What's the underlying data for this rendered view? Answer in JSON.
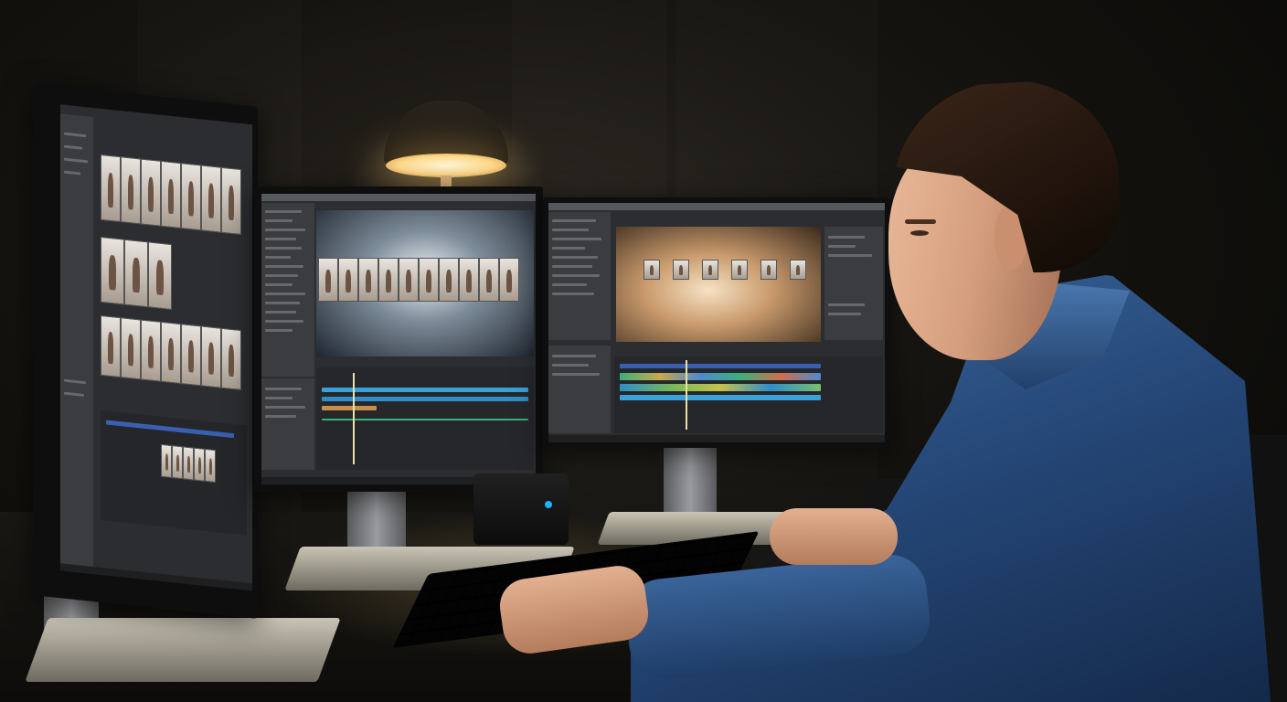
{
  "scene": {
    "kind": "photograph",
    "subject": "video-editor-at-desk",
    "monitors": [
      {
        "name": "left",
        "content": "thumbnail-grid"
      },
      {
        "name": "center",
        "content": "editing-software"
      },
      {
        "name": "right",
        "content": "editing-software"
      }
    ],
    "colors": {
      "shirt": "#2f5a8f",
      "lamp_light": "#ffd98a",
      "ui_panel": "#3a3c40",
      "timeline_blue": "#3aa0d8",
      "timeline_green": "#3bb07a"
    }
  }
}
